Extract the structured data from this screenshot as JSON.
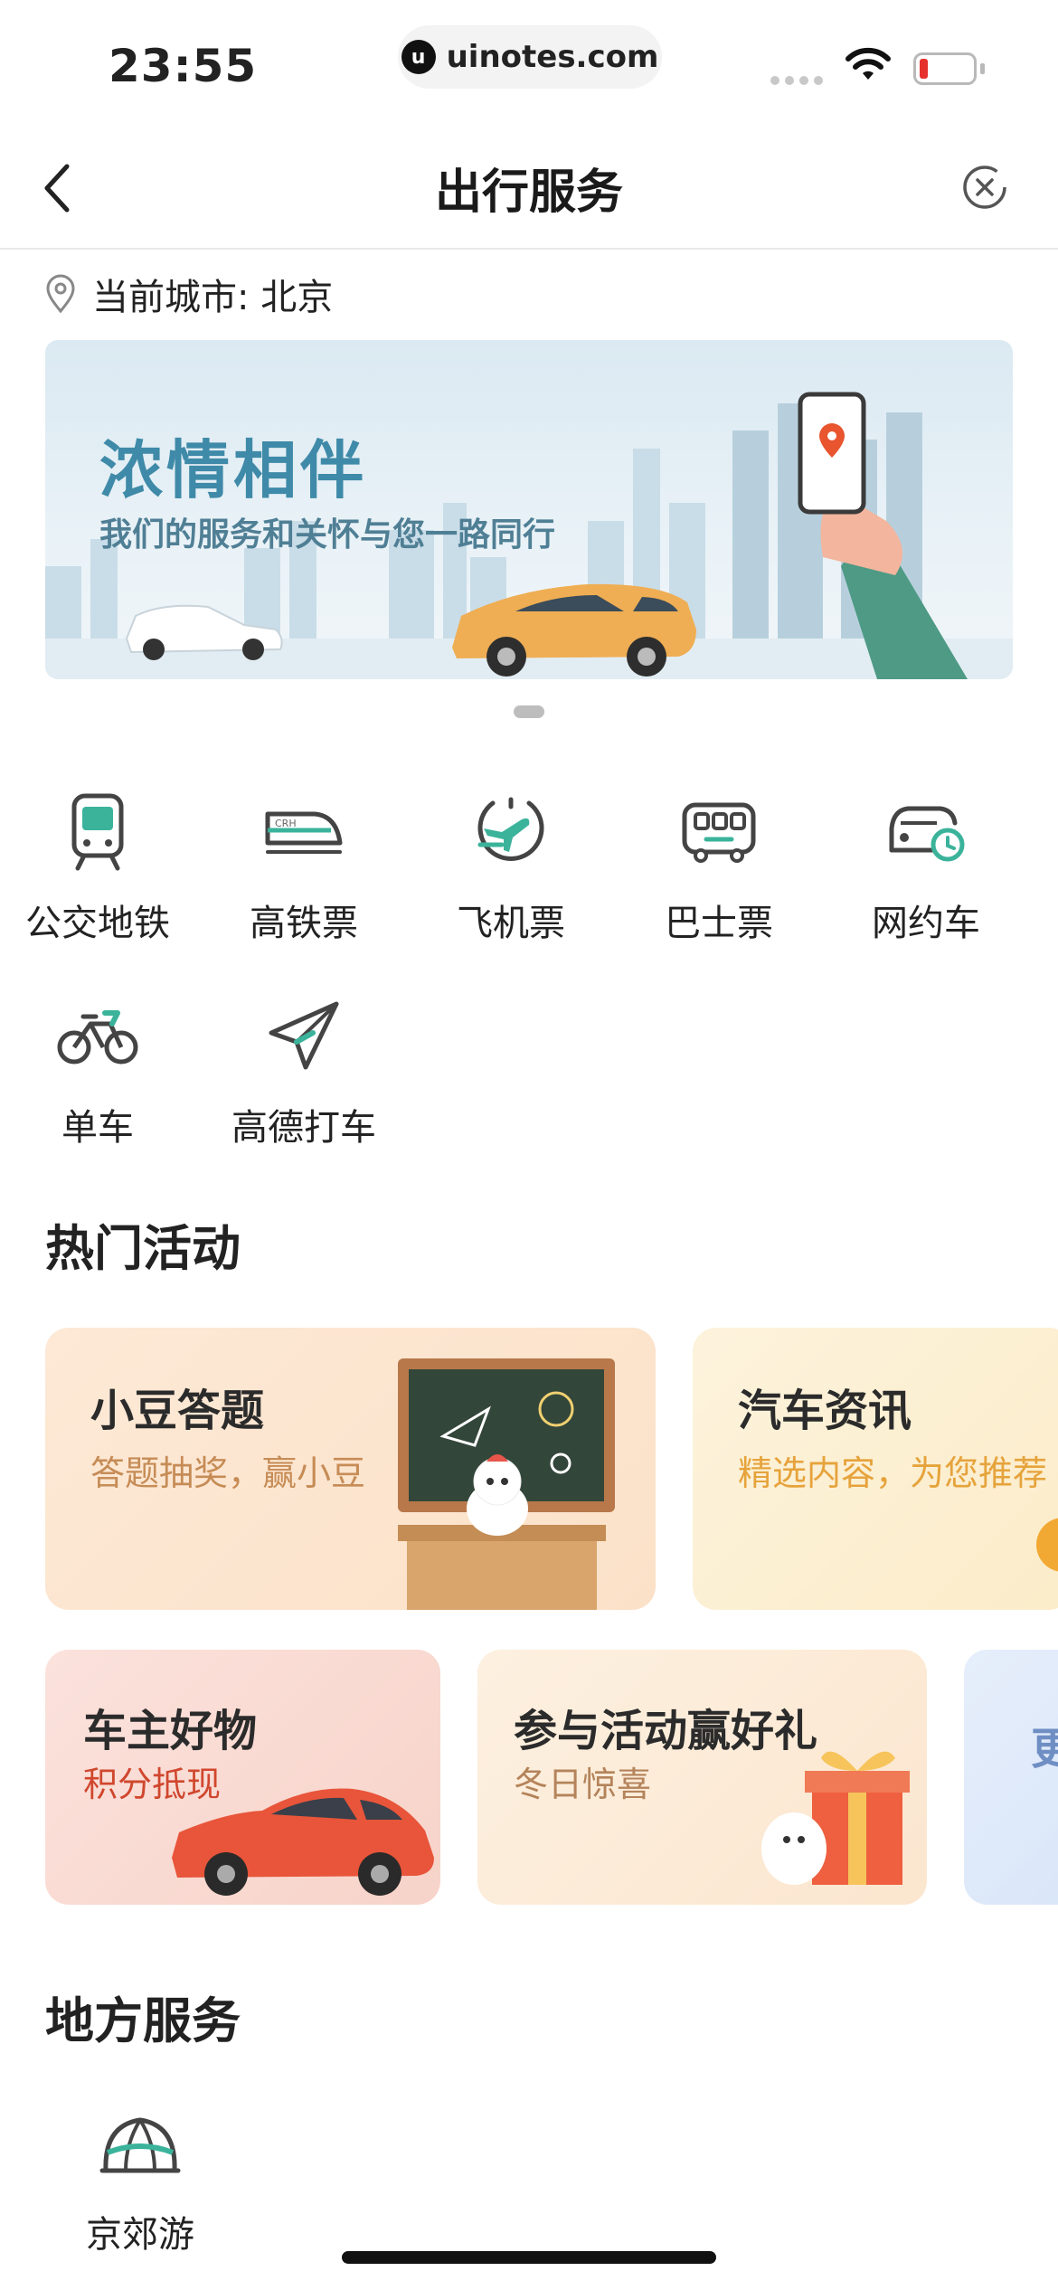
{
  "status_bar": {
    "time": "23:55",
    "url": "uinotes.com"
  },
  "nav": {
    "title": "出行服务"
  },
  "city": {
    "label": "当前城市: 北京"
  },
  "banner": {
    "title": "浓情相伴",
    "subtitle": "我们的服务和关怀与您一路同行"
  },
  "services": [
    {
      "label": "公交地铁",
      "icon": "subway-icon"
    },
    {
      "label": "高铁票",
      "icon": "train-icon"
    },
    {
      "label": "飞机票",
      "icon": "plane-icon"
    },
    {
      "label": "巴士票",
      "icon": "bus-icon"
    },
    {
      "label": "网约车",
      "icon": "ride-hailing-icon"
    },
    {
      "label": "单车",
      "icon": "bike-icon"
    },
    {
      "label": "高德打车",
      "icon": "paper-plane-icon"
    }
  ],
  "hot": {
    "title": "热门活动",
    "cards": [
      {
        "title": "小豆答题",
        "subtitle": "答题抽奖，赢小豆"
      },
      {
        "title": "汽车资讯",
        "subtitle": "精选内容，为您推荐"
      },
      {
        "title": "车主好物",
        "subtitle": "积分抵现"
      },
      {
        "title": "参与活动赢好礼",
        "subtitle": "冬日惊喜"
      },
      {
        "title": "更"
      }
    ]
  },
  "local": {
    "title": "地方服务",
    "items": [
      {
        "label": "京郊游",
        "icon": "tent-icon"
      }
    ]
  },
  "colors": {
    "accent": "#3bb39b",
    "brand_orange": "#e8a040",
    "red": "#d0472e"
  }
}
